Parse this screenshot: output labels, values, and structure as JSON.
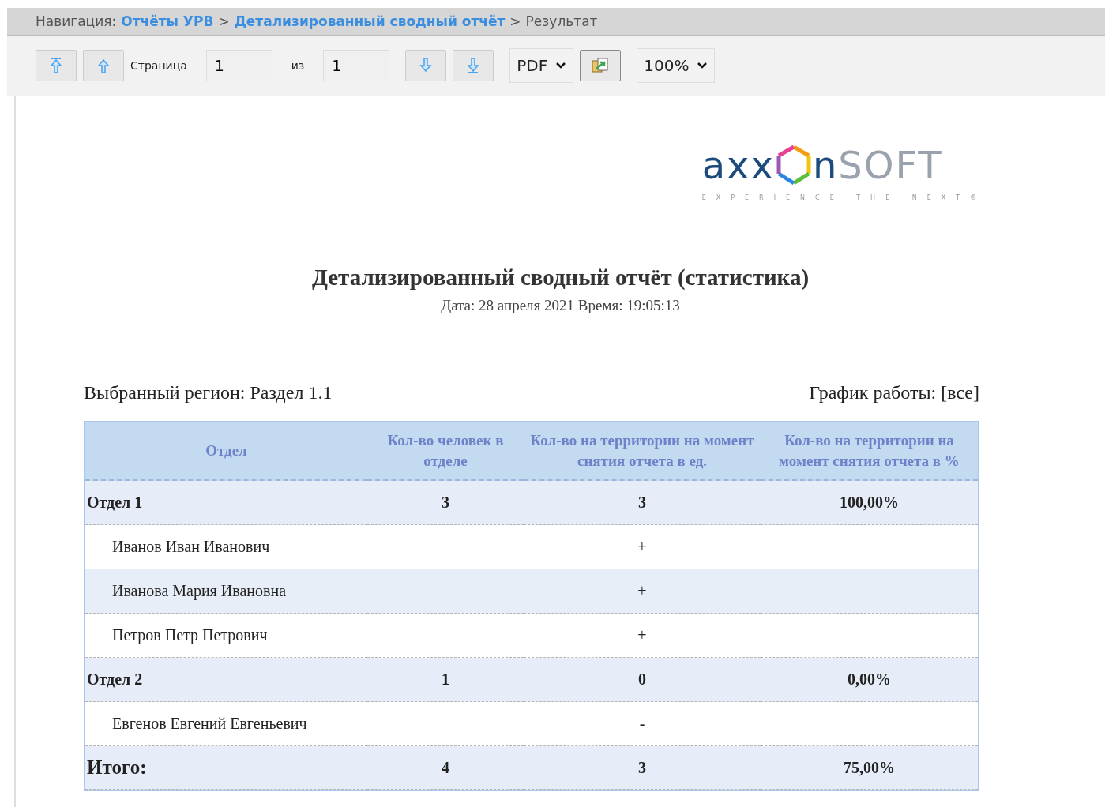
{
  "breadcrumb": {
    "label": "Навигация:",
    "links": [
      "Отчёты УРВ",
      "Детализированный сводный отчёт"
    ],
    "separator": ">",
    "current": "Результат"
  },
  "toolbar": {
    "page_label": "Страница",
    "page_value": "1",
    "of_label": "из",
    "total_value": "1",
    "format": "PDF",
    "zoom": "100%"
  },
  "logo": {
    "part_1": "axx",
    "part_2": "n",
    "part_3": "SOFT",
    "tagline": "EXPERIENCE THE NEXT®"
  },
  "report": {
    "title": "Детализированный сводный отчёт (статистика)",
    "subtitle": "Дата: 28 апреля 2021 Время: 19:05:13",
    "region": "Выбранный регион: Раздел 1.1",
    "schedule": "График работы: [все]"
  },
  "table": {
    "columns": [
      "Отдел",
      "Кол-во человек в отделе",
      "Кол-во на территории на момент снятия отчета в ед.",
      "Кол-во на территории на момент снятия отчета в %"
    ],
    "rows": [
      {
        "kind": "group",
        "cells": [
          "Отдел 1",
          "3",
          "3",
          "100,00%"
        ]
      },
      {
        "kind": "person",
        "cells": [
          "Иванов Иван Иванович",
          "",
          "+",
          ""
        ]
      },
      {
        "kind": "person",
        "cells": [
          "Иванова Мария Ивановна",
          "",
          "+",
          ""
        ]
      },
      {
        "kind": "person",
        "cells": [
          "Петров Петр Петрович",
          "",
          "+",
          ""
        ]
      },
      {
        "kind": "group",
        "cells": [
          "Отдел 2",
          "1",
          "0",
          "0,00%"
        ]
      },
      {
        "kind": "person",
        "cells": [
          "Евгенов Евгений Евгеньевич",
          "",
          "-",
          ""
        ]
      },
      {
        "kind": "total",
        "cells": [
          "Итого:",
          "4",
          "3",
          "75,00%"
        ]
      }
    ]
  }
}
